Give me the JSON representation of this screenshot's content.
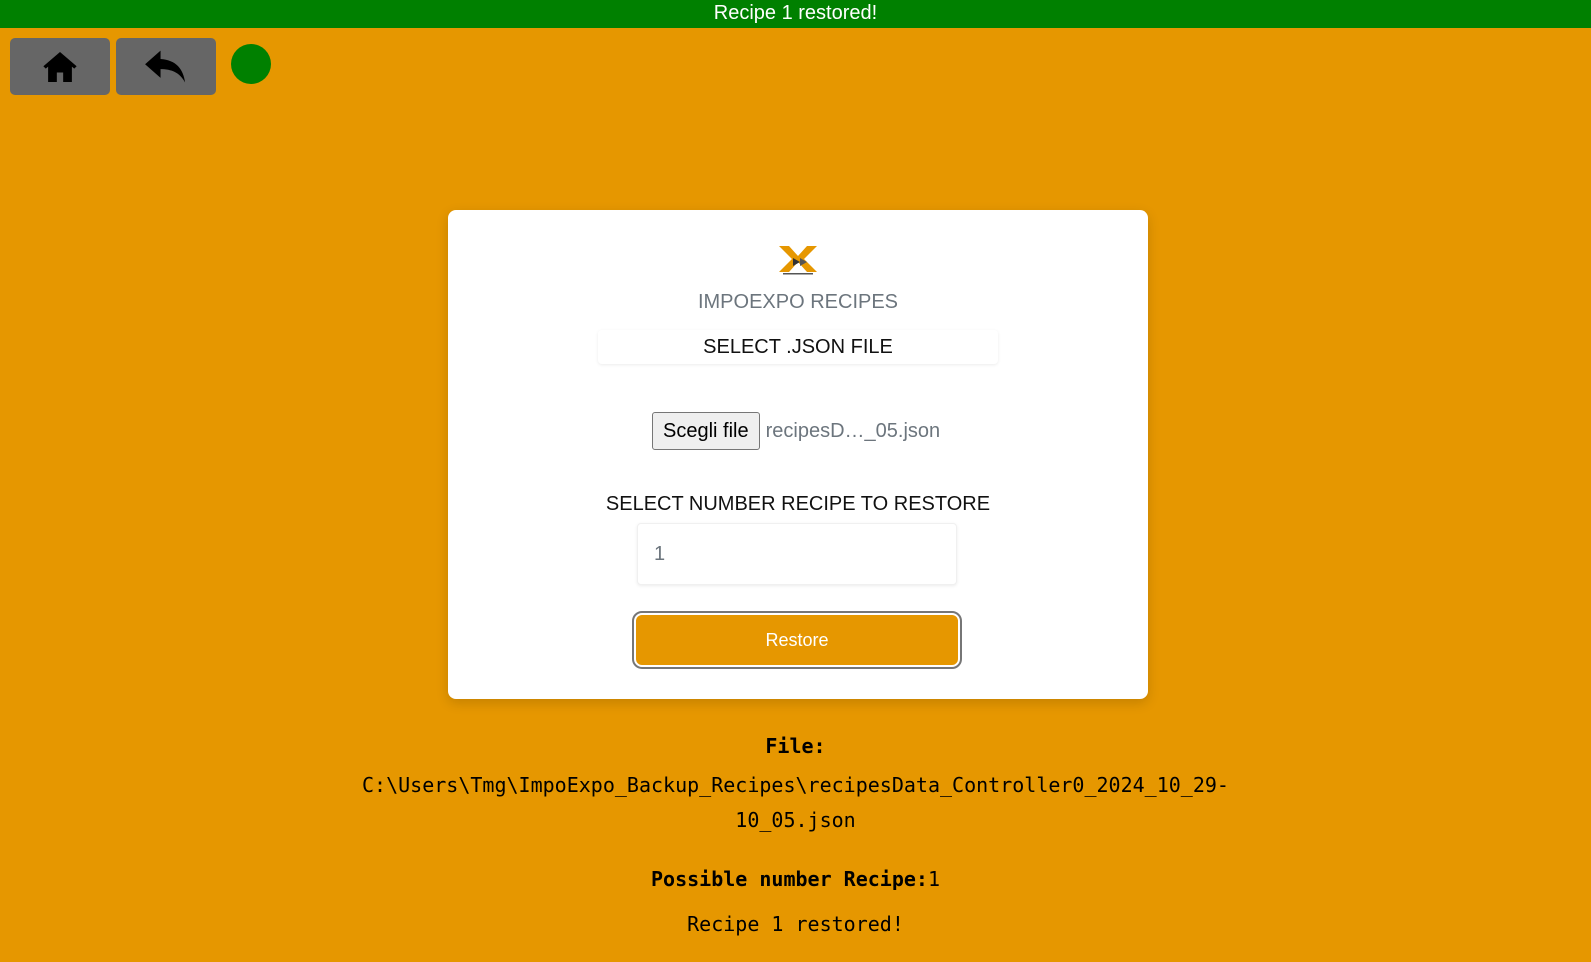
{
  "notification": {
    "text": "Recipe 1 restored!",
    "color": "#008000"
  },
  "toolbar": {
    "home_icon": "home-icon",
    "back_icon": "reply-arrow-icon",
    "status_color": "#008000"
  },
  "card": {
    "logo_icon": "tmg-logo",
    "title": "IMPOEXPO RECIPES",
    "select_file_label": "SELECT .JSON FILE",
    "choose_file_button": "Scegli file",
    "chosen_file_name": "recipesD…_05.json",
    "recipe_number_label": "SELECT NUMBER RECIPE TO RESTORE",
    "recipe_number_value": "1",
    "restore_button": "Restore"
  },
  "result": {
    "file_heading": "File:",
    "file_path_line1": "C:\\Users\\Tmg\\ImpoExpo_Backup_Recipes\\recipesData_Controller0_2024_10_29-",
    "file_path_line2": "10_05.json",
    "possible_label": "Possible number Recipe:",
    "possible_value": "1",
    "restored_message": "Recipe 1 restored!"
  },
  "colors": {
    "background": "#e69700",
    "accent": "#e69700",
    "button_gray": "#666666"
  }
}
